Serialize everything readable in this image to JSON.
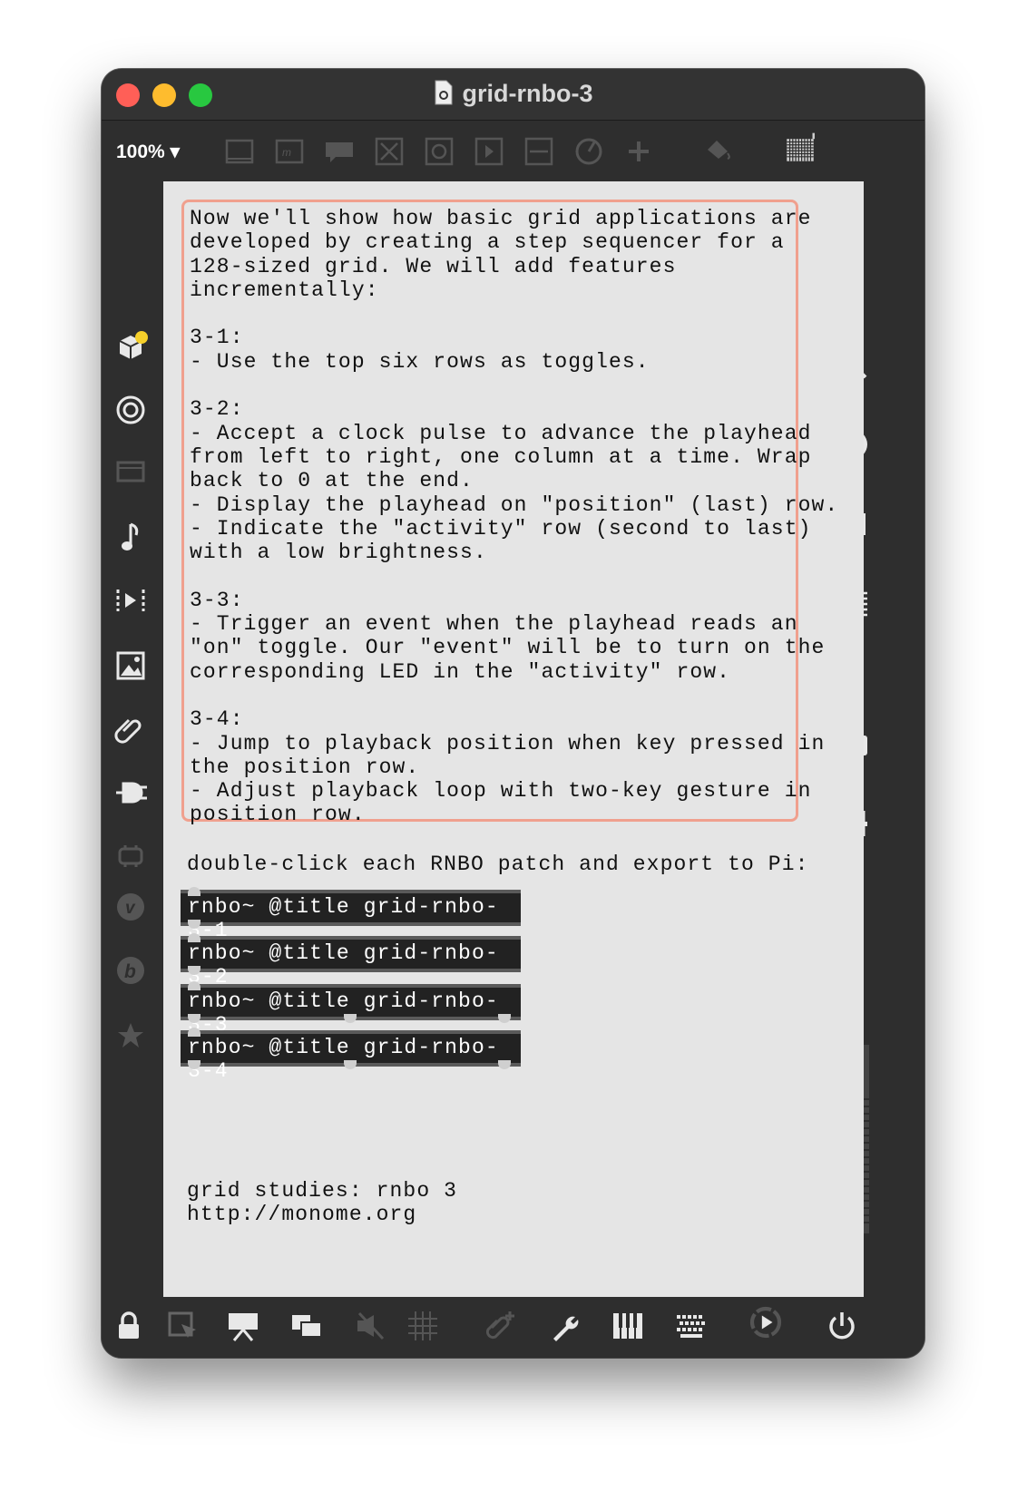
{
  "window": {
    "title": "grid-rnbo-3"
  },
  "toolbar": {
    "zoom": "100%"
  },
  "comment": {
    "text": "Now we'll show how basic grid applications are\ndeveloped by creating a step sequencer for a\n128-sized grid. We will add features\nincrementally:\n\n3-1:\n- Use the top six rows as toggles.\n\n3-2:\n- Accept a clock pulse to advance the playhead\nfrom left to right, one column at a time. Wrap\nback to 0 at the end.\n- Display the playhead on \"position\" (last) row.\n- Indicate the \"activity\" row (second to last)\nwith a low brightness.\n\n3-3:\n- Trigger an event when the playhead reads an\n\"on\" toggle. Our \"event\" will be to turn on the\ncorresponding LED in the \"activity\" row.\n\n3-4:\n- Jump to playback position when key pressed in\nthe position row.\n- Adjust playback loop with two-key gesture in\nposition row."
  },
  "instruction": "double-click each RNBO patch and export to Pi:",
  "objects": [
    "rnbo~ @title grid-rnbo-3-1",
    "rnbo~ @title grid-rnbo-3-2",
    "rnbo~ @title grid-rnbo-3-3",
    "rnbo~ @title grid-rnbo-3-4"
  ],
  "footer": {
    "line1": "grid studies: rnbo 3",
    "line2": "http://monome.org"
  },
  "colors": {
    "comment_border": "#f0a08e",
    "canvas_bg": "#e5e5e5",
    "object_bg": "#222222",
    "chrome": "#2e2e2e"
  },
  "icons": {
    "toolbar": [
      "object-box-icon",
      "message-box-icon",
      "comment-icon",
      "toggle-icon",
      "button-icon",
      "number-icon",
      "slider-icon",
      "dial-icon",
      "add-icon",
      "paint-bucket-icon",
      "grid-icon"
    ],
    "left_sidebar": [
      "packages-icon",
      "target-icon",
      "video-icon",
      "music-note-icon",
      "sequence-icon",
      "image-icon",
      "paperclip-icon",
      "plug-icon",
      "chip-icon",
      "v-icon",
      "b-icon",
      "star-icon"
    ],
    "right_sidebar": [
      "search-icon",
      "info-icon",
      "columns-icon",
      "list-icon",
      "camera-icon",
      "mixer-icon"
    ],
    "bottom": [
      "lock-icon",
      "select-icon",
      "presentation-icon",
      "windows-icon",
      "mute-icon",
      "grid-snap-icon",
      "attach-icon",
      "wrench-icon",
      "piano-icon",
      "keyboard-icon",
      "play-dial-icon",
      "power-icon"
    ]
  }
}
